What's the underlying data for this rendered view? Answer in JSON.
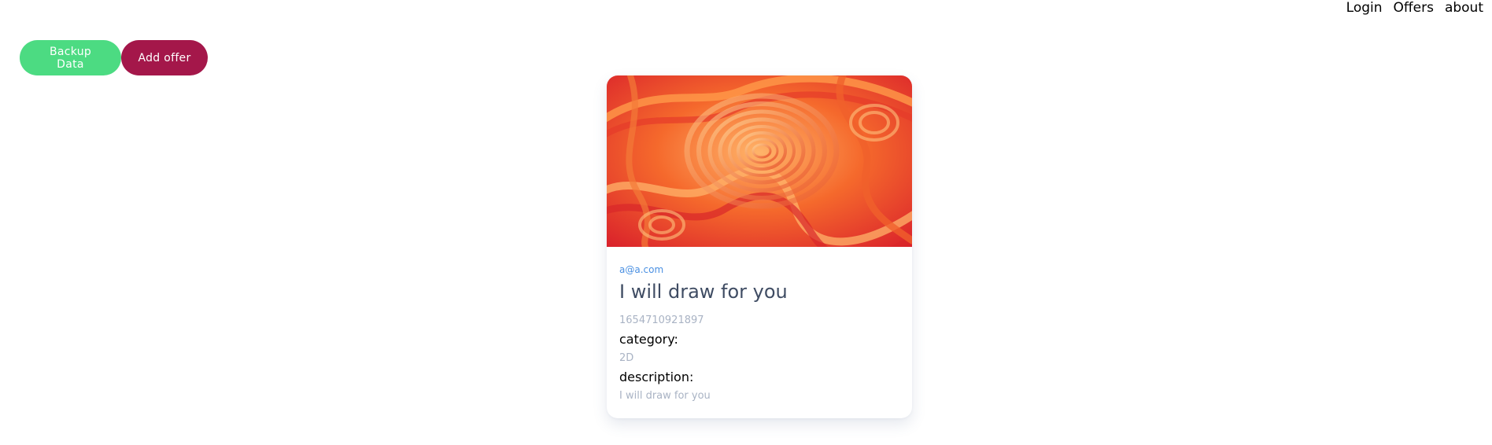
{
  "nav": {
    "items": [
      "Login",
      "Offers",
      "about"
    ]
  },
  "actions": {
    "backup_label": "Backup Data",
    "add_label": "Add offer"
  },
  "colors": {
    "backup_button": "#4cdb82",
    "add_button": "#a4174a"
  },
  "offer": {
    "owner": "a@a.com",
    "title": "I will draw for you",
    "id": "1654710921897",
    "category_label": "category:",
    "category": "2D",
    "description_label": "description:",
    "description": "I will draw for you",
    "image_icon": "abstract-swirl-image"
  }
}
